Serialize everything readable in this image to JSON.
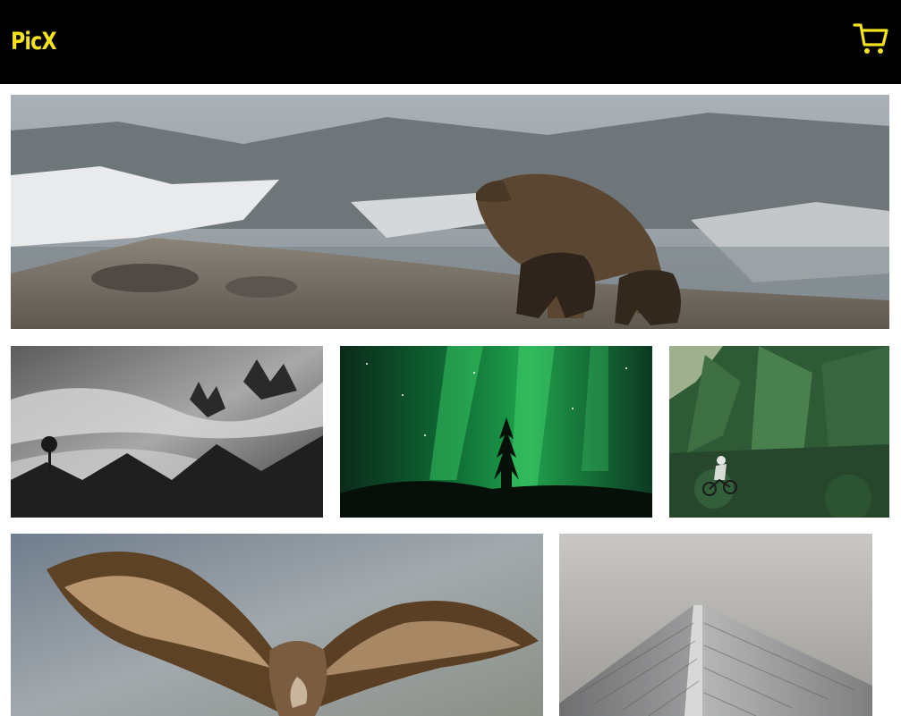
{
  "header": {
    "logo": "PicX",
    "cart_icon": "shopping-cart-icon",
    "background": "#000000",
    "accent": "#f5e21f"
  },
  "gallery": {
    "photos": [
      {
        "subject": "grizzly-bear-with-cubs-photo"
      },
      {
        "subject": "misty-forest-photo"
      },
      {
        "subject": "northern-lights-photo"
      },
      {
        "subject": "mountain-biker-in-forest-photo"
      },
      {
        "subject": "vulture-in-flight-photo"
      },
      {
        "subject": "skyscraper-looking-up-photo"
      }
    ]
  }
}
